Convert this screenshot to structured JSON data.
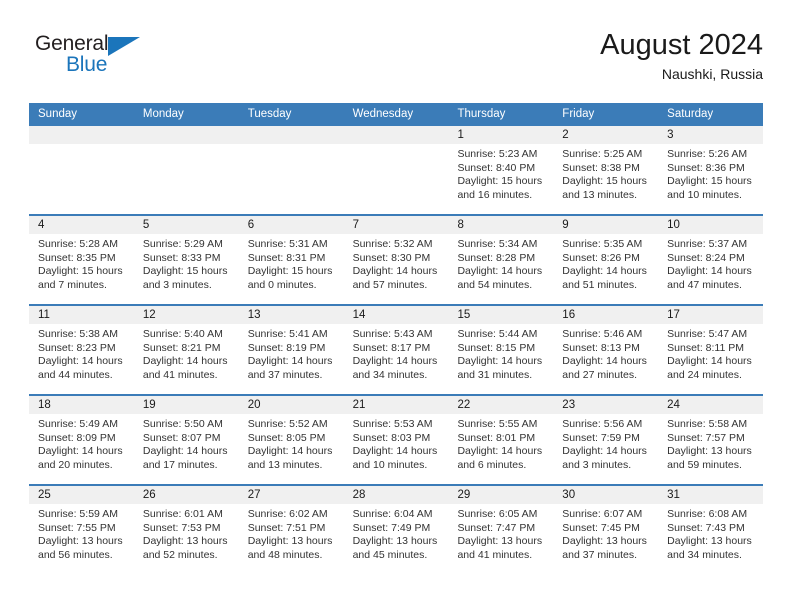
{
  "brand": {
    "name_part1": "General",
    "name_part2": "Blue",
    "logo_icon": "triangle-mark",
    "accent_color": "#1b75bb"
  },
  "header": {
    "title": "August 2024",
    "subtitle": "Naushki, Russia"
  },
  "theme": {
    "header_row_bg": "#3b7cb8",
    "daynum_bg": "#f0f0f0",
    "row_divider": "#3b7cb8",
    "text": "#1a1a1a"
  },
  "calendar": {
    "weekday_headers": [
      "Sunday",
      "Monday",
      "Tuesday",
      "Wednesday",
      "Thursday",
      "Friday",
      "Saturday"
    ],
    "leading_blanks": 4,
    "days": [
      {
        "day": "1",
        "sunrise": "Sunrise: 5:23 AM",
        "sunset": "Sunset: 8:40 PM",
        "daylight1": "Daylight: 15 hours",
        "daylight2": "and 16 minutes."
      },
      {
        "day": "2",
        "sunrise": "Sunrise: 5:25 AM",
        "sunset": "Sunset: 8:38 PM",
        "daylight1": "Daylight: 15 hours",
        "daylight2": "and 13 minutes."
      },
      {
        "day": "3",
        "sunrise": "Sunrise: 5:26 AM",
        "sunset": "Sunset: 8:36 PM",
        "daylight1": "Daylight: 15 hours",
        "daylight2": "and 10 minutes."
      },
      {
        "day": "4",
        "sunrise": "Sunrise: 5:28 AM",
        "sunset": "Sunset: 8:35 PM",
        "daylight1": "Daylight: 15 hours",
        "daylight2": "and 7 minutes."
      },
      {
        "day": "5",
        "sunrise": "Sunrise: 5:29 AM",
        "sunset": "Sunset: 8:33 PM",
        "daylight1": "Daylight: 15 hours",
        "daylight2": "and 3 minutes."
      },
      {
        "day": "6",
        "sunrise": "Sunrise: 5:31 AM",
        "sunset": "Sunset: 8:31 PM",
        "daylight1": "Daylight: 15 hours",
        "daylight2": "and 0 minutes."
      },
      {
        "day": "7",
        "sunrise": "Sunrise: 5:32 AM",
        "sunset": "Sunset: 8:30 PM",
        "daylight1": "Daylight: 14 hours",
        "daylight2": "and 57 minutes."
      },
      {
        "day": "8",
        "sunrise": "Sunrise: 5:34 AM",
        "sunset": "Sunset: 8:28 PM",
        "daylight1": "Daylight: 14 hours",
        "daylight2": "and 54 minutes."
      },
      {
        "day": "9",
        "sunrise": "Sunrise: 5:35 AM",
        "sunset": "Sunset: 8:26 PM",
        "daylight1": "Daylight: 14 hours",
        "daylight2": "and 51 minutes."
      },
      {
        "day": "10",
        "sunrise": "Sunrise: 5:37 AM",
        "sunset": "Sunset: 8:24 PM",
        "daylight1": "Daylight: 14 hours",
        "daylight2": "and 47 minutes."
      },
      {
        "day": "11",
        "sunrise": "Sunrise: 5:38 AM",
        "sunset": "Sunset: 8:23 PM",
        "daylight1": "Daylight: 14 hours",
        "daylight2": "and 44 minutes."
      },
      {
        "day": "12",
        "sunrise": "Sunrise: 5:40 AM",
        "sunset": "Sunset: 8:21 PM",
        "daylight1": "Daylight: 14 hours",
        "daylight2": "and 41 minutes."
      },
      {
        "day": "13",
        "sunrise": "Sunrise: 5:41 AM",
        "sunset": "Sunset: 8:19 PM",
        "daylight1": "Daylight: 14 hours",
        "daylight2": "and 37 minutes."
      },
      {
        "day": "14",
        "sunrise": "Sunrise: 5:43 AM",
        "sunset": "Sunset: 8:17 PM",
        "daylight1": "Daylight: 14 hours",
        "daylight2": "and 34 minutes."
      },
      {
        "day": "15",
        "sunrise": "Sunrise: 5:44 AM",
        "sunset": "Sunset: 8:15 PM",
        "daylight1": "Daylight: 14 hours",
        "daylight2": "and 31 minutes."
      },
      {
        "day": "16",
        "sunrise": "Sunrise: 5:46 AM",
        "sunset": "Sunset: 8:13 PM",
        "daylight1": "Daylight: 14 hours",
        "daylight2": "and 27 minutes."
      },
      {
        "day": "17",
        "sunrise": "Sunrise: 5:47 AM",
        "sunset": "Sunset: 8:11 PM",
        "daylight1": "Daylight: 14 hours",
        "daylight2": "and 24 minutes."
      },
      {
        "day": "18",
        "sunrise": "Sunrise: 5:49 AM",
        "sunset": "Sunset: 8:09 PM",
        "daylight1": "Daylight: 14 hours",
        "daylight2": "and 20 minutes."
      },
      {
        "day": "19",
        "sunrise": "Sunrise: 5:50 AM",
        "sunset": "Sunset: 8:07 PM",
        "daylight1": "Daylight: 14 hours",
        "daylight2": "and 17 minutes."
      },
      {
        "day": "20",
        "sunrise": "Sunrise: 5:52 AM",
        "sunset": "Sunset: 8:05 PM",
        "daylight1": "Daylight: 14 hours",
        "daylight2": "and 13 minutes."
      },
      {
        "day": "21",
        "sunrise": "Sunrise: 5:53 AM",
        "sunset": "Sunset: 8:03 PM",
        "daylight1": "Daylight: 14 hours",
        "daylight2": "and 10 minutes."
      },
      {
        "day": "22",
        "sunrise": "Sunrise: 5:55 AM",
        "sunset": "Sunset: 8:01 PM",
        "daylight1": "Daylight: 14 hours",
        "daylight2": "and 6 minutes."
      },
      {
        "day": "23",
        "sunrise": "Sunrise: 5:56 AM",
        "sunset": "Sunset: 7:59 PM",
        "daylight1": "Daylight: 14 hours",
        "daylight2": "and 3 minutes."
      },
      {
        "day": "24",
        "sunrise": "Sunrise: 5:58 AM",
        "sunset": "Sunset: 7:57 PM",
        "daylight1": "Daylight: 13 hours",
        "daylight2": "and 59 minutes."
      },
      {
        "day": "25",
        "sunrise": "Sunrise: 5:59 AM",
        "sunset": "Sunset: 7:55 PM",
        "daylight1": "Daylight: 13 hours",
        "daylight2": "and 56 minutes."
      },
      {
        "day": "26",
        "sunrise": "Sunrise: 6:01 AM",
        "sunset": "Sunset: 7:53 PM",
        "daylight1": "Daylight: 13 hours",
        "daylight2": "and 52 minutes."
      },
      {
        "day": "27",
        "sunrise": "Sunrise: 6:02 AM",
        "sunset": "Sunset: 7:51 PM",
        "daylight1": "Daylight: 13 hours",
        "daylight2": "and 48 minutes."
      },
      {
        "day": "28",
        "sunrise": "Sunrise: 6:04 AM",
        "sunset": "Sunset: 7:49 PM",
        "daylight1": "Daylight: 13 hours",
        "daylight2": "and 45 minutes."
      },
      {
        "day": "29",
        "sunrise": "Sunrise: 6:05 AM",
        "sunset": "Sunset: 7:47 PM",
        "daylight1": "Daylight: 13 hours",
        "daylight2": "and 41 minutes."
      },
      {
        "day": "30",
        "sunrise": "Sunrise: 6:07 AM",
        "sunset": "Sunset: 7:45 PM",
        "daylight1": "Daylight: 13 hours",
        "daylight2": "and 37 minutes."
      },
      {
        "day": "31",
        "sunrise": "Sunrise: 6:08 AM",
        "sunset": "Sunset: 7:43 PM",
        "daylight1": "Daylight: 13 hours",
        "daylight2": "and 34 minutes."
      }
    ]
  }
}
